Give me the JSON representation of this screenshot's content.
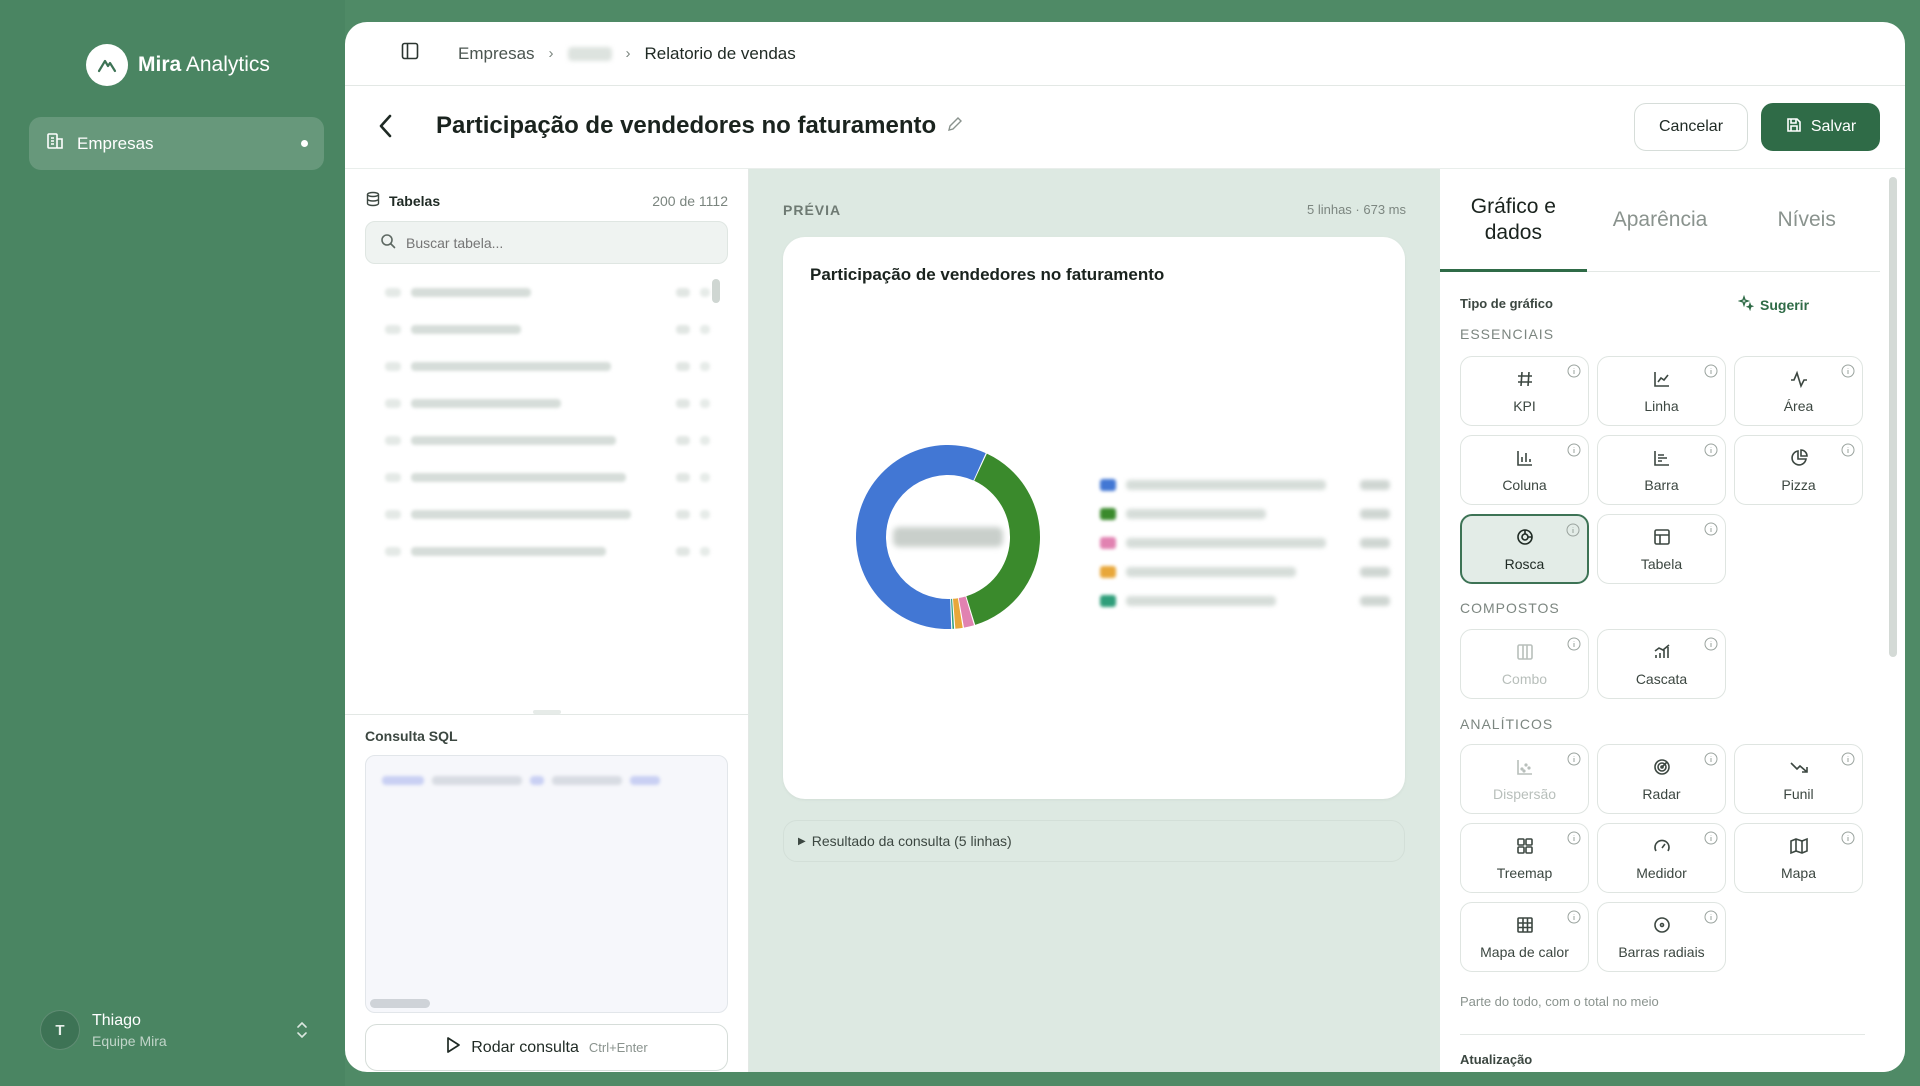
{
  "app": {
    "brand_bold": "Mira",
    "brand_light": "Analytics"
  },
  "sidebar": {
    "items": [
      {
        "label": "Empresas",
        "active": true
      }
    ]
  },
  "user": {
    "initial": "T",
    "name": "Thiago",
    "team": "Equipe Mira"
  },
  "breadcrumb": {
    "first": "Empresas",
    "last": "Relatorio de vendas"
  },
  "header": {
    "title": "Participação de vendedores no faturamento",
    "cancel_label": "Cancelar",
    "save_label": "Salvar"
  },
  "tables": {
    "title": "Tabelas",
    "count": "200 de 1112",
    "search_placeholder": "Buscar tabela..."
  },
  "sql": {
    "label": "Consulta SQL",
    "run_label": "Rodar consulta",
    "run_shortcut": "Ctrl+Enter"
  },
  "preview": {
    "label": "PRÉVIA",
    "meta": "5 linhas · 673 ms",
    "chart_title": "Participação de vendedores no faturamento",
    "result_toggle": "Resultado da consulta (5 linhas)"
  },
  "chart_data": {
    "type": "pie",
    "donut": true,
    "title": "Participação de vendedores no faturamento",
    "values": [
      57.5,
      38.5,
      2.0,
      1.5,
      0.5
    ],
    "colors": [
      "#4277d4",
      "#3a8a2c",
      "#e182b1",
      "#e8a73a",
      "#2f9e7a"
    ]
  },
  "config": {
    "tabs": [
      "Gráfico e dados",
      "Aparência",
      "Níveis"
    ],
    "chart_type_label": "Tipo de gráfico",
    "suggest_label": "Sugerir",
    "sections": {
      "essentials": "ESSENCIAIS",
      "composite": "COMPOSTOS",
      "analytics": "ANALÍTICOS"
    },
    "types": {
      "kpi": "KPI",
      "line": "Linha",
      "area": "Área",
      "column": "Coluna",
      "bar": "Barra",
      "pie": "Pizza",
      "donut": "Rosca",
      "table": "Tabela",
      "combo": "Combo",
      "waterfall": "Cascata",
      "scatter": "Dispersão",
      "radar": "Radar",
      "funnel": "Funil",
      "treemap": "Treemap",
      "gauge": "Medidor",
      "map": "Mapa",
      "heatmap": "Mapa de calor",
      "radial_bars": "Barras radiais"
    },
    "selected_type": "Rosca",
    "hint": "Parte do todo, com o total no meio",
    "update_label": "Atualização"
  },
  "colors": {
    "accent": "#2f6b47",
    "sidebar": "#4a8562",
    "preview_bg": "#dde9e2"
  }
}
